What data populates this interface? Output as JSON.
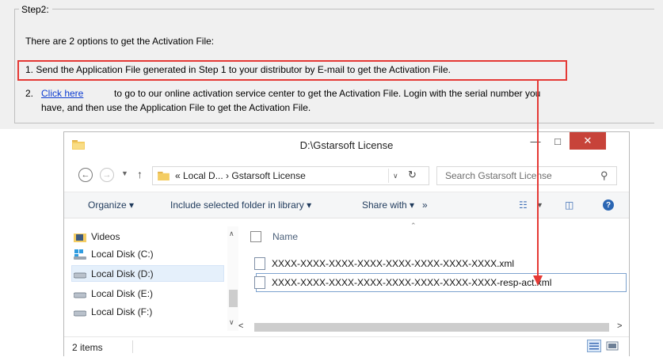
{
  "step": {
    "legend": "Step2:",
    "intro": "There are 2 options to get the Activation File:",
    "option1": "1.  Send the Application File generated in Step 1 to your distributor by E-mail to get the Activation File.",
    "option2_num": "2.",
    "option2_link": "Click here",
    "option2_text": "to go to our online activation service center to get the Activation File. Login with the serial number you",
    "option2_text2": "have, and then use the Application File to get the Activation File."
  },
  "window": {
    "title": "D:\\Gstarsoft License",
    "address": "« Local D...  ›  Gstarsoft License",
    "search_placeholder": "Search Gstarsoft License",
    "commands": {
      "organize": "Organize ▾",
      "include": "Include selected folder in library ▾",
      "share": "Share with ▾",
      "more": "»"
    },
    "nav": {
      "videos": "Videos",
      "c": "Local Disk (C:)",
      "d": "Local Disk (D:)",
      "e": "Local Disk (E:)",
      "f": "Local Disk (F:)"
    },
    "column_name": "Name",
    "files": [
      "XXXX-XXXX-XXXX-XXXX-XXXX-XXXX-XXXX-XXXX.xml",
      "XXXX-XXXX-XXXX-XXXX-XXXX-XXXX-XXXX-XXXX-resp-act.xml"
    ],
    "status": "2 items"
  },
  "colors": {
    "highlight": "#e53935",
    "link": "#0b3bd1",
    "close": "#c7433a",
    "selection": "#e5f0fb"
  }
}
